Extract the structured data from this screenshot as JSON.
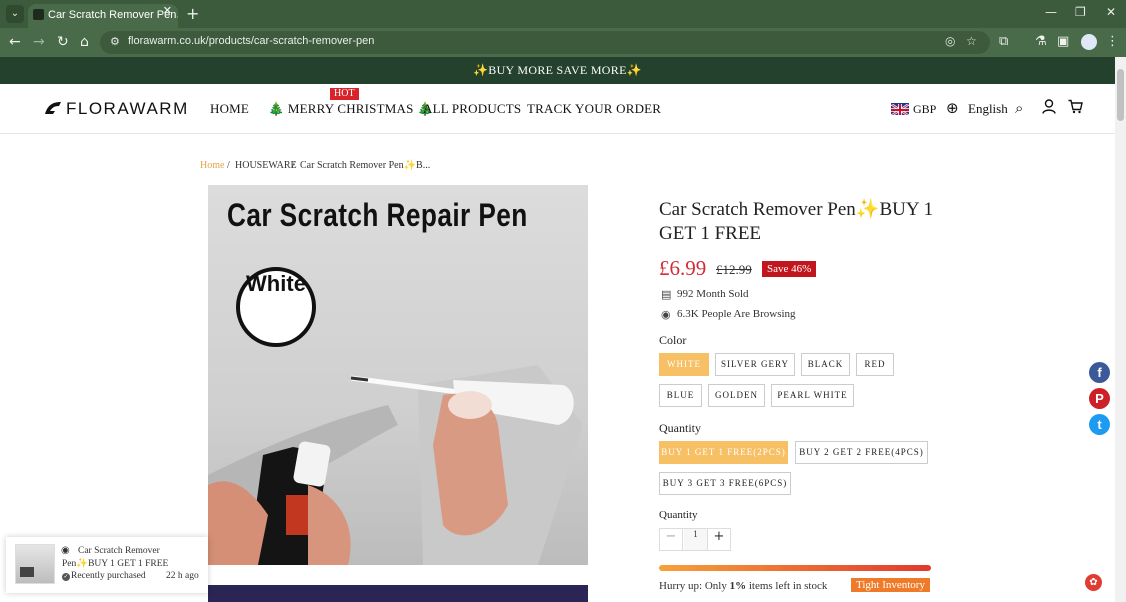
{
  "browser": {
    "tab_title": "Car Scratch Remover Pen✨BU",
    "tab_close": "✕",
    "new_tab": "+",
    "url": "florawarm.co.uk/products/car-scratch-remover-pen",
    "win_minimize": "—",
    "win_restore": "❐",
    "win_close": "✕"
  },
  "announcement": "✨BUY MORE SAVE MORE✨",
  "header": {
    "logo": "FLORAWARM",
    "nav": [
      "HOME",
      "🎄 MERRY CHRISTMAS 🎄",
      "ALL PRODUCTS",
      "TRACK YOUR ORDER"
    ],
    "hot_badge": "HOT",
    "currency": "GBP",
    "language": "English"
  },
  "breadcrumb": {
    "home": "Home",
    "sep": "/",
    "category": "HOUSEWARE",
    "current": "Car Scratch Remover Pen✨B..."
  },
  "image": {
    "title": "Car Scratch Repair  Pen",
    "badge": "White"
  },
  "product": {
    "title": "Car Scratch Remover Pen✨BUY 1 GET 1 FREE",
    "price": "£6.99",
    "old_price": "£12.99",
    "save_badge": "Save 46%",
    "sold": "992 Month Sold",
    "browsing": "6.3K People Are Browsing",
    "color_label": "Color",
    "colors": [
      "WHITE",
      "SILVER GERY",
      "BLACK",
      "RED",
      "BLUE",
      "GOLDEN",
      "PEARL WHITE"
    ],
    "selected_color": "WHITE",
    "bundle_label": "Quantity",
    "bundles": [
      "BUY 1 GET 1 FREE(2PCS)",
      "BUY 2 GET 2 FREE(4PCS)",
      "BUY 3 GET 3 FREE(6PCS)"
    ],
    "selected_bundle": "BUY 1 GET 1 FREE(2PCS)",
    "qty_label": "Quantity",
    "qty_value": "1",
    "qty_minus": "−",
    "qty_plus": "+",
    "stock_percent": 100,
    "hurry_prefix": "Hurry up:  Only ",
    "hurry_pct": "1%",
    "hurry_suffix": " items left in stock",
    "tight_badge": "Tight Inventory"
  },
  "social": {
    "facebook": "f",
    "pinterest": "P",
    "twitter": "t"
  },
  "popup": {
    "title": "Car Scratch Remover Pen✨BUY 1 GET 1 FREE",
    "status": "Recently purchased",
    "time": "22 h ago"
  },
  "colors": {
    "announcement_bg": "#23412c",
    "price": "#d22c36",
    "selected_option": "#f7c065",
    "save_badge": "#c2161f",
    "tight_badge": "#ef7b2a",
    "hot_badge": "#d8232a",
    "facebook": "#3b5998",
    "pinterest": "#cb2027",
    "twitter": "#1d9bf0"
  }
}
